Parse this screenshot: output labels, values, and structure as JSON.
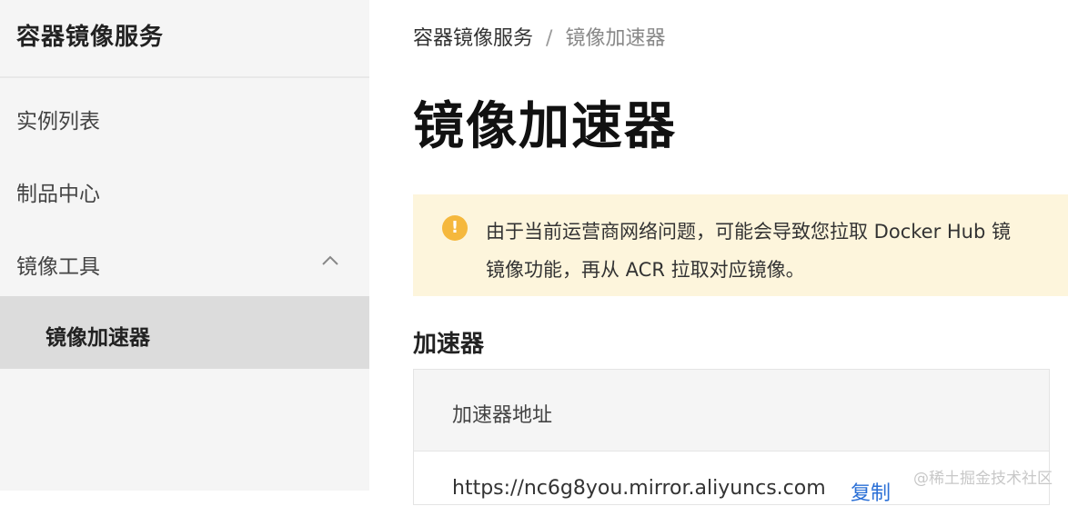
{
  "sidebar": {
    "title": "容器镜像服务",
    "items": [
      {
        "label": "实例列表"
      },
      {
        "label": "制品中心"
      },
      {
        "label": "镜像工具",
        "icon": "chevron-up-icon"
      }
    ],
    "subitem": {
      "label": "镜像加速器"
    }
  },
  "breadcrumb": {
    "root": "容器镜像服务",
    "separator": "/",
    "current": "镜像加速器"
  },
  "page": {
    "title": "镜像加速器"
  },
  "alert": {
    "icon": "warning-icon",
    "line1": "由于当前运营商网络问题，可能会导致您拉取 Docker Hub 镜",
    "line2": "镜像功能，再从 ACR 拉取对应镜像。"
  },
  "section": {
    "title": "加速器"
  },
  "table": {
    "header": "加速器地址",
    "url": "https://nc6g8you.mirror.aliyuncs.com",
    "copy_label": "复制"
  },
  "watermark": "@稀土掘金技术社区",
  "colors": {
    "alert_bg": "#fdf5dc",
    "alert_icon": "#f5b83d",
    "link": "#2a6fd6",
    "selected_nav": "#dcdcdc"
  }
}
